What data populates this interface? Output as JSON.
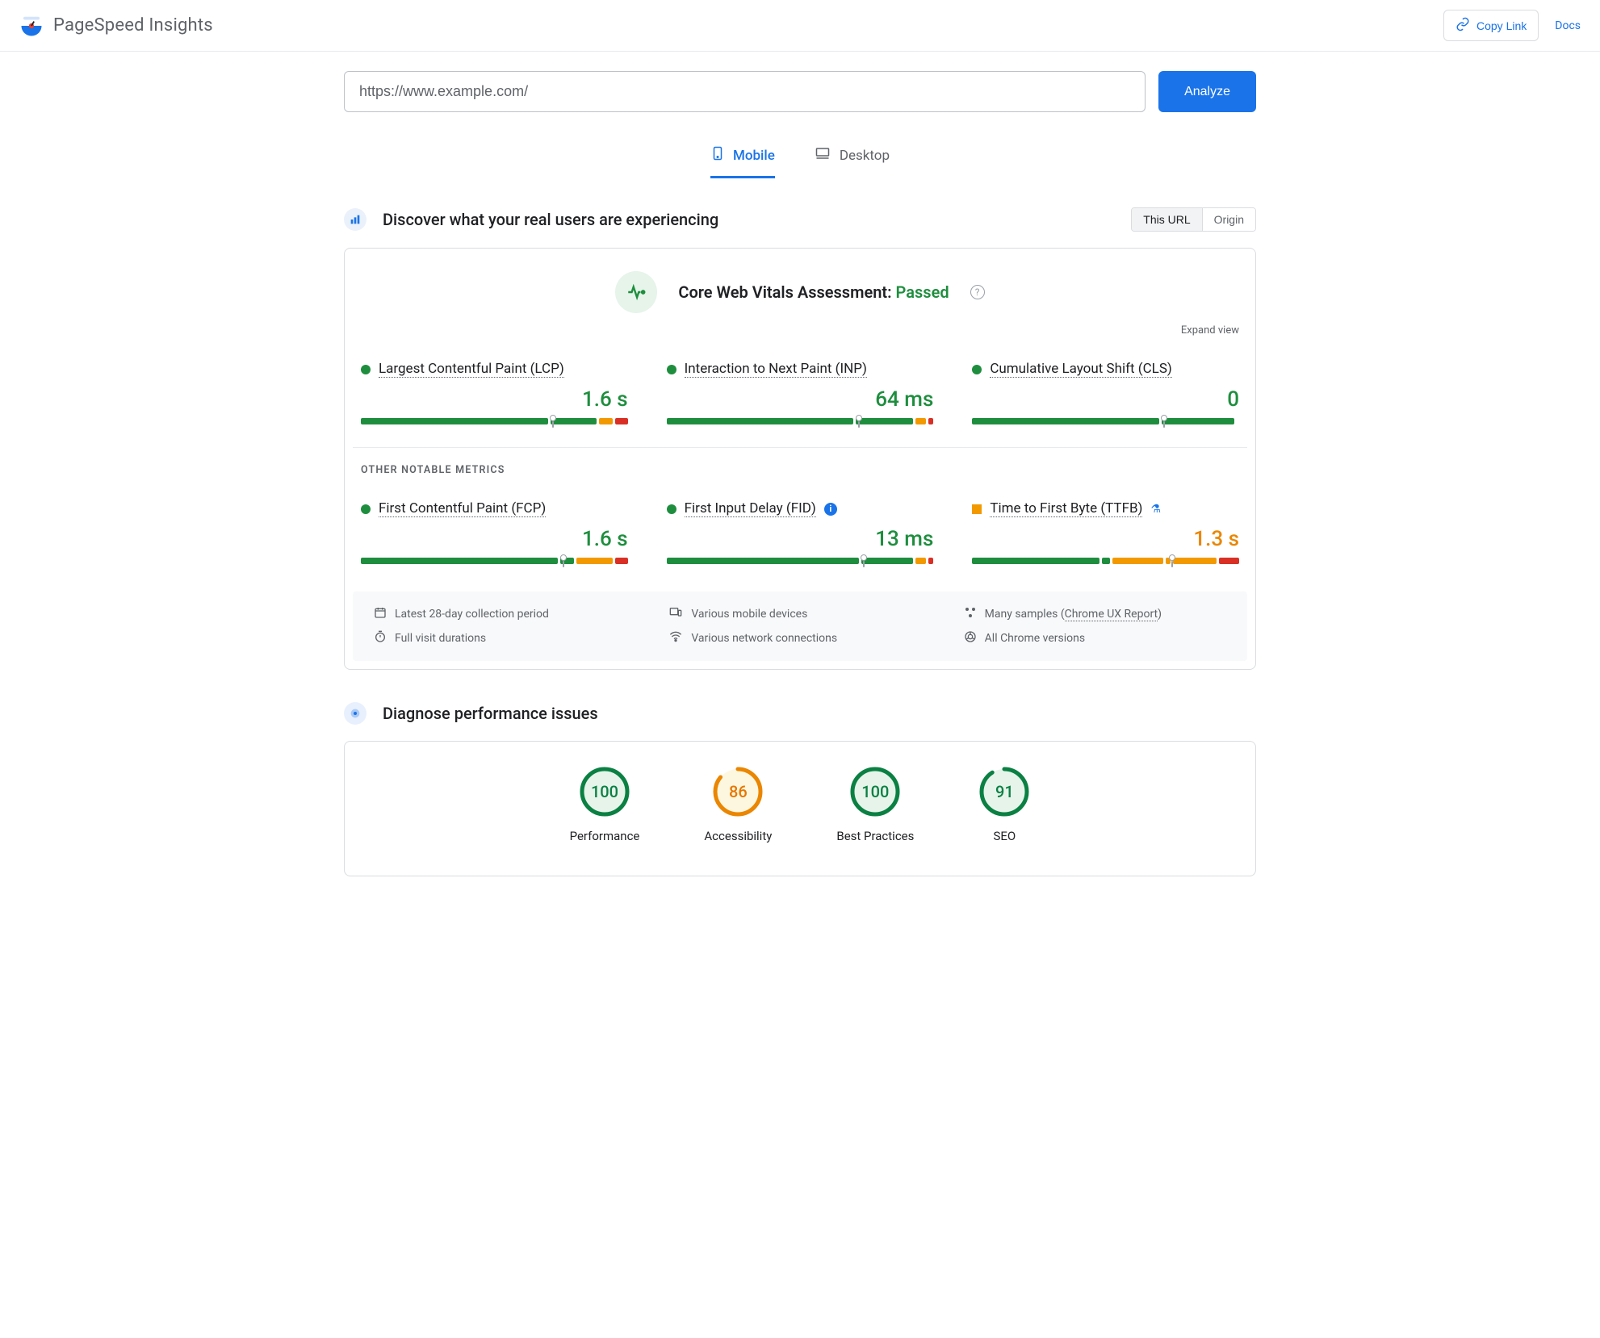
{
  "header": {
    "title": "PageSpeed Insights",
    "copy_link": "Copy Link",
    "docs": "Docs"
  },
  "url_input_value": "https://www.example.com/",
  "analyze_label": "Analyze",
  "tabs": {
    "mobile": "Mobile",
    "desktop": "Desktop"
  },
  "section1": {
    "title": "Discover what your real users are experiencing",
    "toggle_this": "This URL",
    "toggle_origin": "Origin"
  },
  "assessment": {
    "label": "Core Web Vitals Assessment: ",
    "status": "Passed"
  },
  "expand_view": "Expand view",
  "metrics_primary": [
    {
      "name": "Largest Contentful Paint (LCP)",
      "value": "1.6 s",
      "status": "good",
      "dist": [
        72,
        18,
        5,
        5
      ],
      "marker": 72
    },
    {
      "name": "Interaction to Next Paint (INP)",
      "value": "64 ms",
      "status": "good",
      "dist": [
        72,
        22,
        4,
        2
      ],
      "marker": 72,
      "badge": ""
    },
    {
      "name": "Cumulative Layout Shift (CLS)",
      "value": "0",
      "status": "good",
      "dist": [
        72,
        28,
        0,
        0
      ],
      "marker": 72
    }
  ],
  "other_label": "OTHER NOTABLE METRICS",
  "metrics_other": [
    {
      "name": "First Contentful Paint (FCP)",
      "value": "1.6 s",
      "status": "good",
      "dist": [
        76,
        5,
        14,
        5
      ],
      "marker": 76
    },
    {
      "name": "First Input Delay (FID)",
      "value": "13 ms",
      "status": "good",
      "dist": [
        74,
        20,
        4,
        2
      ],
      "marker": 74,
      "badge": "info"
    },
    {
      "name": "Time to First Byte (TTFB)",
      "value": "1.3 s",
      "status": "ni",
      "dist": [
        50,
        3,
        20,
        2,
        17,
        8
      ],
      "marker": 75,
      "badge": "flask"
    }
  ],
  "footer_items": [
    "Latest 28-day collection period",
    "Various mobile devices",
    "Many samples (",
    "Chrome UX Report",
    ")",
    "Full visit durations",
    "Various network connections",
    "All Chrome versions"
  ],
  "section2": {
    "title": "Diagnose performance issues"
  },
  "gauges": [
    {
      "label": "Performance",
      "value": 100,
      "color": "green"
    },
    {
      "label": "Accessibility",
      "value": 86,
      "color": "orange"
    },
    {
      "label": "Best Practices",
      "value": 100,
      "color": "green"
    },
    {
      "label": "SEO",
      "value": 91,
      "color": "green"
    }
  ],
  "colors": {
    "green": "#0b8043",
    "orange": "#ea8600"
  }
}
